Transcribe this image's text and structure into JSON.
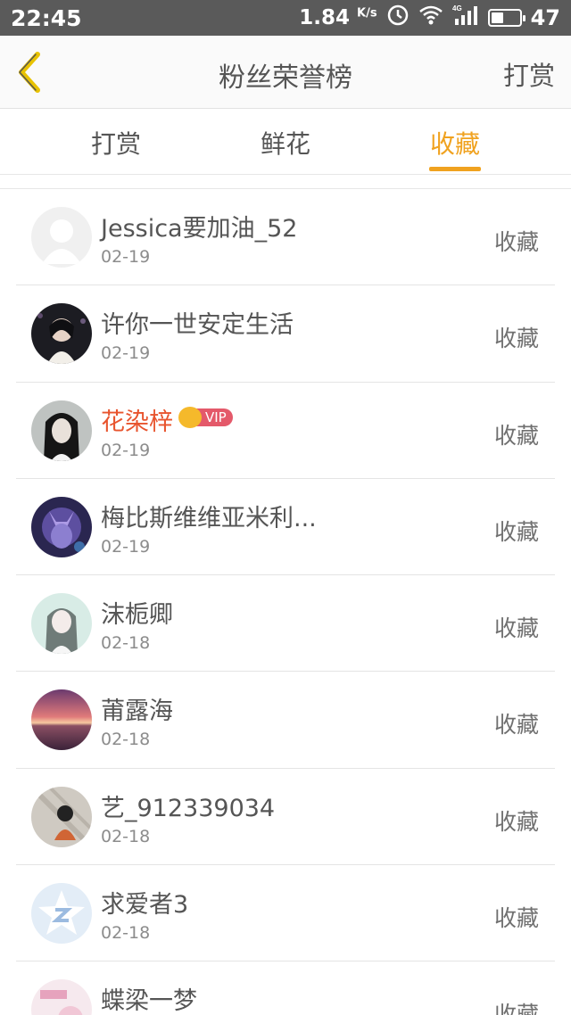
{
  "status_bar": {
    "time": "22:45",
    "net_speed": "1.84",
    "net_unit": "K/s",
    "network_type": "4G",
    "battery_level": "47"
  },
  "header": {
    "title": "粉丝荣誉榜",
    "action_label": "打赏"
  },
  "tabs": [
    {
      "label": "打赏",
      "active": false
    },
    {
      "label": "鲜花",
      "active": false
    },
    {
      "label": "收藏",
      "active": true
    }
  ],
  "colors": {
    "accent": "#f0a21f",
    "vip_name": "#e8542e",
    "vip_badge": "#e4596a",
    "status_bar": "#5a5a5a"
  },
  "fans": [
    {
      "name": "Jessica要加油_52",
      "date": "02-19",
      "type": "收藏",
      "avatar": "default-avatar"
    },
    {
      "name": "许你一世安定生活",
      "date": "02-19",
      "type": "收藏",
      "avatar": "photo-avatar"
    },
    {
      "name": "花染梓",
      "date": "02-19",
      "type": "收藏",
      "avatar": "photo-avatar",
      "vip": "VIP"
    },
    {
      "name": "梅比斯维维亚米利...",
      "date": "02-19",
      "type": "收藏",
      "avatar": "photo-avatar"
    },
    {
      "name": "沫栀卿",
      "date": "02-18",
      "type": "收藏",
      "avatar": "photo-avatar"
    },
    {
      "name": "莆露海",
      "date": "02-18",
      "type": "收藏",
      "avatar": "sunset-avatar"
    },
    {
      "name": "艺_912339034",
      "date": "02-18",
      "type": "收藏",
      "avatar": "photo-avatar"
    },
    {
      "name": "求爱者3",
      "date": "02-18",
      "type": "收藏",
      "avatar": "qzone-star-avatar"
    },
    {
      "name": "蝶梁一梦",
      "date": "",
      "type": "收藏",
      "avatar": "photo-avatar"
    }
  ]
}
